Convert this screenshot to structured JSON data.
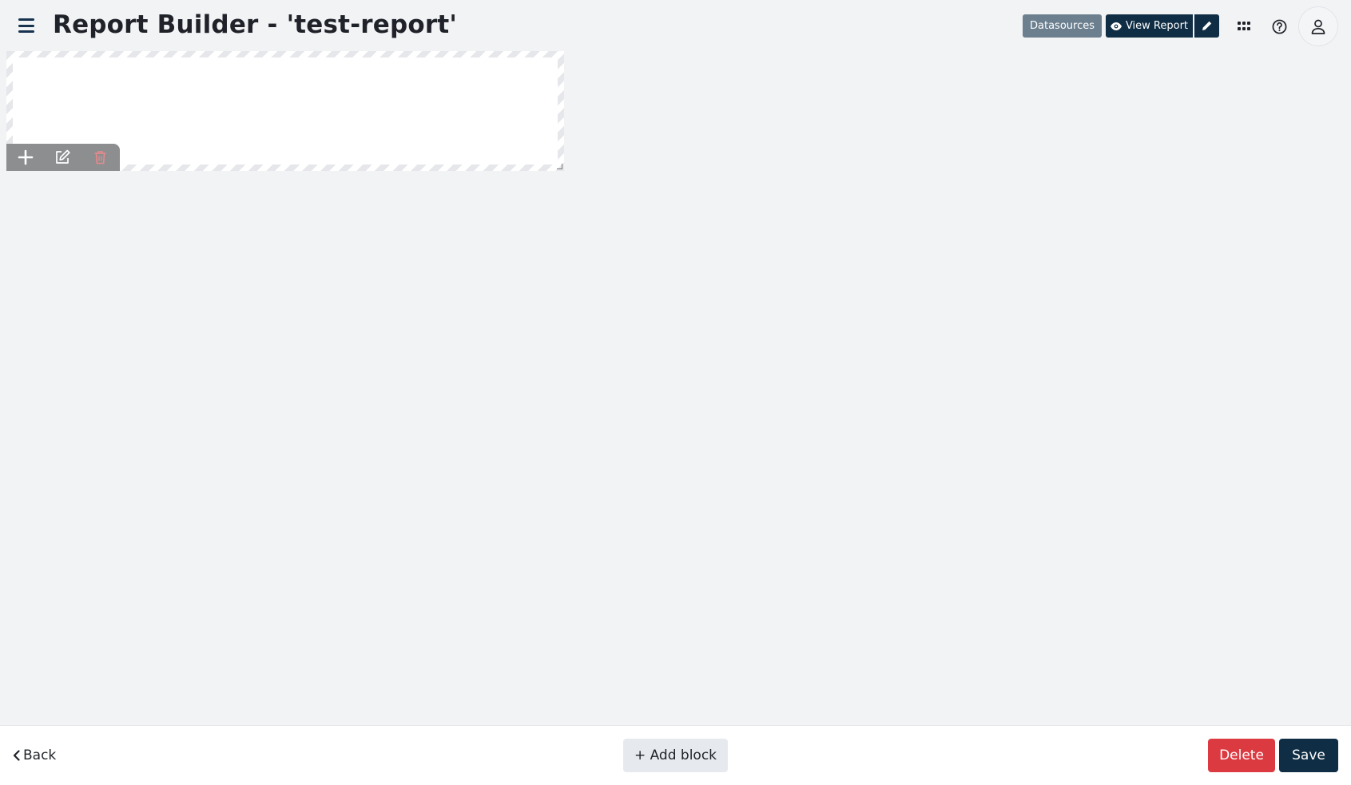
{
  "header": {
    "title": "Report Builder - 'test-report'",
    "datasources_label": "Datasources",
    "view_report_label": "View Report"
  },
  "block": {
    "toolbar": [
      "plus-icon",
      "edit-icon",
      "trash-icon"
    ]
  },
  "footer": {
    "back_label": "Back",
    "add_block_label": "+ Add block",
    "delete_label": "Delete",
    "save_label": "Save"
  },
  "colors": {
    "primary": "#0f2d44",
    "secondary": "#6b7f8f",
    "danger": "#dc3a41",
    "background": "#f2f3f5"
  }
}
